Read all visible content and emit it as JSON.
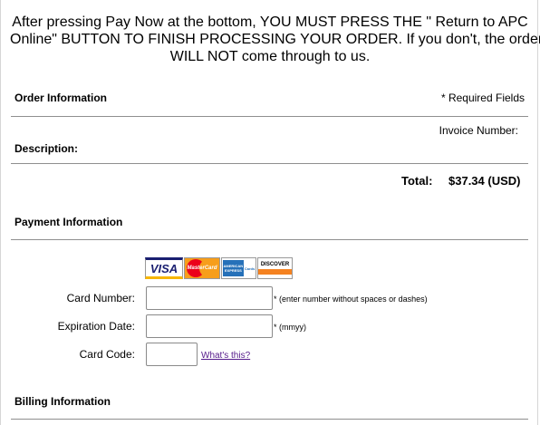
{
  "notice": {
    "line1": "After pressing Pay Now at the bottom, YOU MUST PRESS THE \" Return to APC",
    "line2": "Online\" BUTTON TO FINISH PROCESSING YOUR ORDER. If you don't, the order",
    "line3": "WILL NOT come through to us."
  },
  "order": {
    "title": "Order Information",
    "required_note": "* Required Fields",
    "invoice_label": "Invoice Number:",
    "description_label": "Description:",
    "total_label": "Total:",
    "total_value": "$37.34 (USD)"
  },
  "payment": {
    "title": "Payment Information",
    "card_logos": [
      {
        "name": "visa-logo",
        "text": "VISA",
        "color": "#1a1f71"
      },
      {
        "name": "mastercard-logo",
        "text": "MasterCard",
        "color": "#eb001b"
      },
      {
        "name": "amex-logo",
        "text": "AMERICAN EXPRESS",
        "color": "#2671b9"
      },
      {
        "name": "discover-logo",
        "text": "DISCOVER",
        "color": "#f58220"
      }
    ],
    "card_number": {
      "label": "Card Number:",
      "value": "",
      "hint": "* (enter number without spaces or dashes)"
    },
    "expiration": {
      "label": "Expiration Date:",
      "value": "",
      "hint": "* (mmyy)"
    },
    "card_code": {
      "label": "Card Code:",
      "value": "",
      "link": "What's this?"
    }
  },
  "billing": {
    "title": "Billing Information"
  }
}
